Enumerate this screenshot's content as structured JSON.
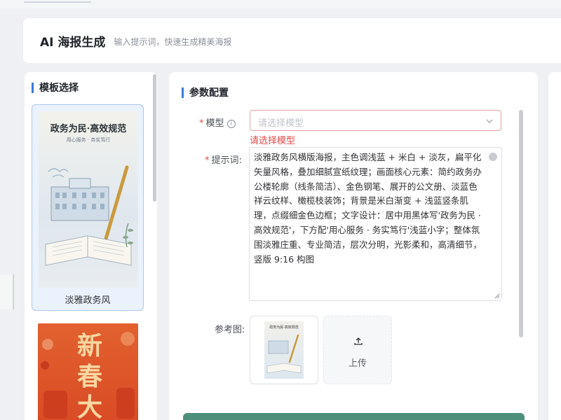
{
  "header": {
    "title": "AI 海报生成",
    "subtitle": "输入提示词，快速生成精美海报"
  },
  "templates": {
    "section_title": "模板选择",
    "items": [
      {
        "label": "淡雅政务风",
        "poster_title": "政务为民·高效规范",
        "poster_sub": "用心服务 · 务实笃行",
        "selected": true
      },
      {
        "poster_title": "新春大",
        "selected": false
      }
    ]
  },
  "config": {
    "section_title": "参数配置",
    "model": {
      "label": "模型",
      "placeholder": "请选择模型",
      "error": "请选择模型",
      "required": true,
      "info_icon": "info-icon"
    },
    "prompt": {
      "label": "提示词:",
      "required": true,
      "value": "淡雅政务风横版海报，主色调浅蓝 + 米白 + 淡灰，扁平化矢量风格，叠加细腻宣纸纹理；画面核心元素：简约政务办公楼轮廓（线条简洁）、金色钢笔、展开的公文册、淡蓝色祥云纹样、橄榄枝装饰；背景是米白渐变 + 浅蓝竖条肌理，点缀细金色边框；文字设计：居中用黑体写'政务为民 · 高效规范'，下方配'用心服务 · 务实笃行'浅蓝小字；整体氛围淡雅庄重、专业简洁，层次分明，光影柔和，高清细节，竖版 9:16 构图"
    },
    "reference": {
      "label": "参考图:",
      "thumb_title": "政务为民·高效规范",
      "upload_label": "上传"
    }
  },
  "colors": {
    "accent": "#3a7ad9",
    "error": "#e04b4b",
    "primary_button": "#4e8f7c",
    "selected_card_bg": "#eaf2fd"
  }
}
